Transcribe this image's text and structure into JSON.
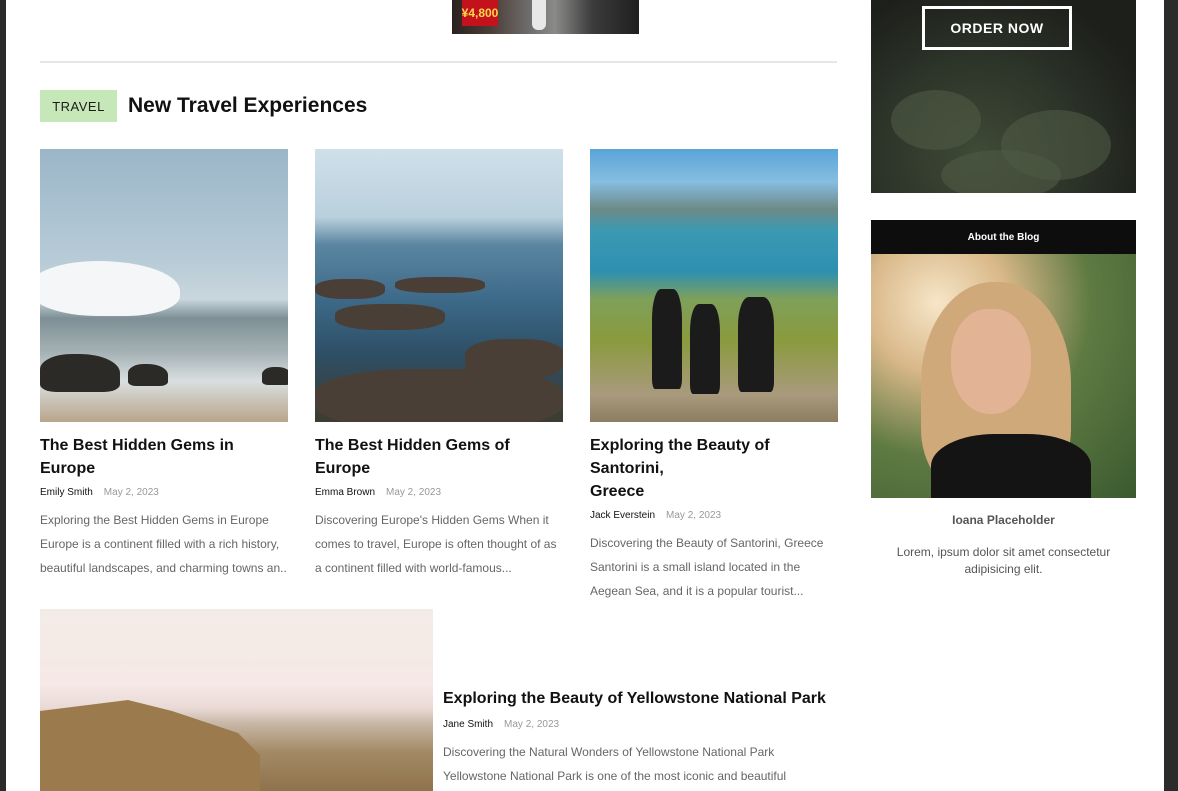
{
  "top_image": {
    "sign_text": "¥4,800"
  },
  "category": {
    "badge": "TRAVEL",
    "title": "New Travel Experiences"
  },
  "posts": [
    {
      "title_lines": [
        "The Best Hidden Gems in Europe"
      ],
      "author": "Emily Smith",
      "date": "May 2, 2023",
      "excerpt_lines": [
        "Exploring the Best Hidden Gems in Europe",
        "Europe is a continent filled with a rich history,",
        "beautiful landscapes, and charming towns an..."
      ]
    },
    {
      "title_lines": [
        "The Best Hidden Gems of Europe"
      ],
      "author": "Emma Brown",
      "date": "May 2, 2023",
      "excerpt_lines": [
        "Discovering Europe's Hidden Gems When it",
        "comes to travel, Europe is often thought of as",
        "a continent filled with world-famous..."
      ]
    },
    {
      "title_lines": [
        "Exploring the Beauty of Santorini,",
        "Greece"
      ],
      "author": "Jack Everstein",
      "date": "May 2, 2023",
      "excerpt_lines": [
        "Discovering the Beauty of Santorini, Greece",
        "Santorini is a small island located in the",
        "Aegean Sea, and it is a popular tourist..."
      ]
    }
  ],
  "featured": {
    "title": "Exploring the Beauty of Yellowstone National Park",
    "author": "Jane Smith",
    "date": "May 2, 2023",
    "excerpt_lines": [
      "Discovering the Natural Wonders of Yellowstone National Park",
      "Yellowstone National Park is one of the most iconic and beautiful"
    ]
  },
  "sidebar": {
    "order_button": "ORDER NOW",
    "about_heading": "About the Blog",
    "author_name": "Ioana Placeholder",
    "bio": "Lorem, ipsum dolor sit amet consectetur adipisicing elit."
  },
  "colors": {
    "badge_bg": "#c6e8b8",
    "about_head_bg": "#0d0d0d"
  }
}
